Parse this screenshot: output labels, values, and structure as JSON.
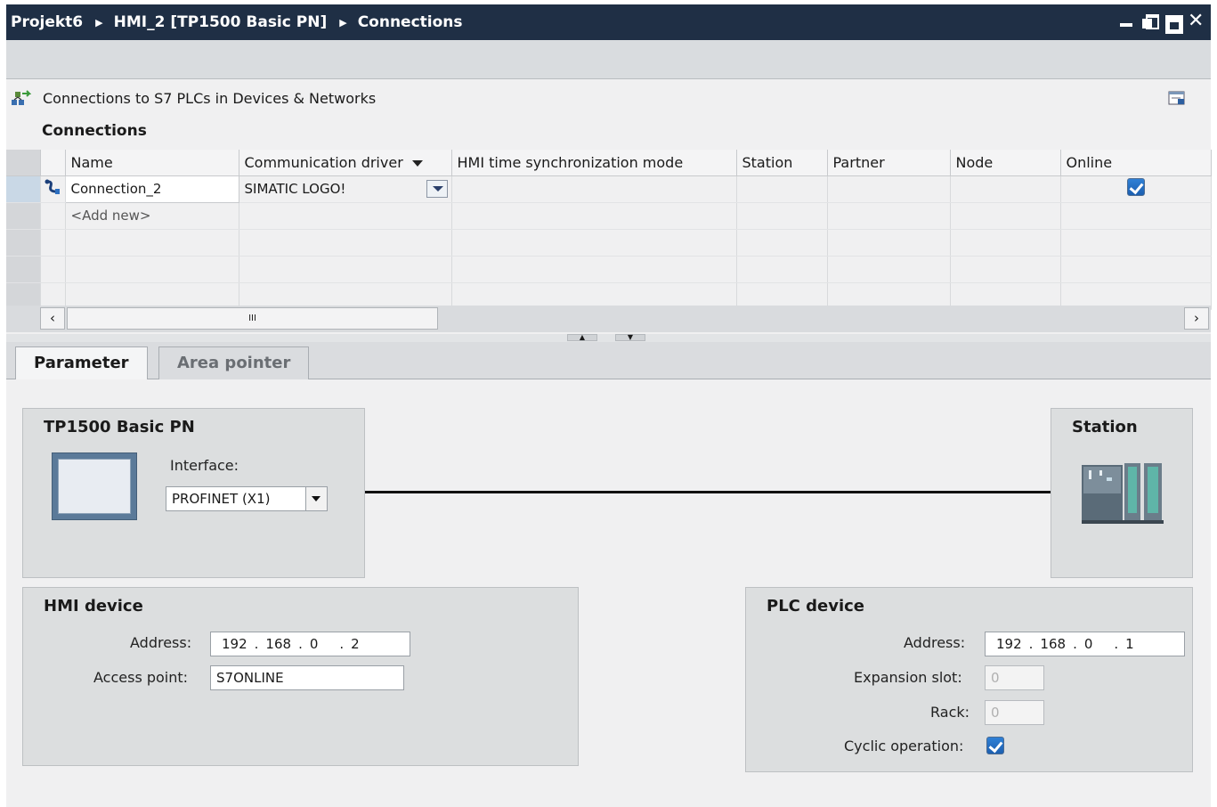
{
  "titlebar": {
    "crumbs": [
      "Projekt6",
      "HMI_2 [TP1500 Basic PN]",
      "Connections"
    ]
  },
  "editor": {
    "header_title": "Connections to S7 PLCs in Devices & Networks",
    "section_label": "Connections",
    "columns": [
      "Name",
      "Communication driver",
      "HMI time synchronization mode",
      "Station",
      "Partner",
      "Node",
      "Online"
    ],
    "rows": [
      {
        "name": "Connection_2",
        "driver": "SIMATIC LOGO!",
        "sync_mode": "",
        "station": "",
        "partner": "",
        "node": "",
        "online": true
      }
    ],
    "add_new": "<Add new>",
    "scroll_thumb": "III"
  },
  "tabs": [
    {
      "label": "Parameter",
      "active": true
    },
    {
      "label": "Area pointer",
      "active": false
    }
  ],
  "parameter": {
    "device_title": "TP1500 Basic PN",
    "interface_label": "Interface:",
    "interface_value": "PROFINET (X1)",
    "station_title": "Station",
    "hmi": {
      "title": "HMI device",
      "address_label": "Address:",
      "address": [
        "192",
        "168",
        "0",
        "2"
      ],
      "access_point_label": "Access point:",
      "access_point": "S7ONLINE"
    },
    "plc": {
      "title": "PLC device",
      "address_label": "Address:",
      "address": [
        "192",
        "168",
        "0",
        "1"
      ],
      "expansion_slot_label": "Expansion slot:",
      "expansion_slot": "0",
      "rack_label": "Rack:",
      "rack": "0",
      "cyclic_label": "Cyclic operation:",
      "cyclic": true
    }
  },
  "colors": {
    "titlebar": "#1f2f45",
    "checkbox": "#1d5fb0",
    "panel": "#dcdedf"
  }
}
